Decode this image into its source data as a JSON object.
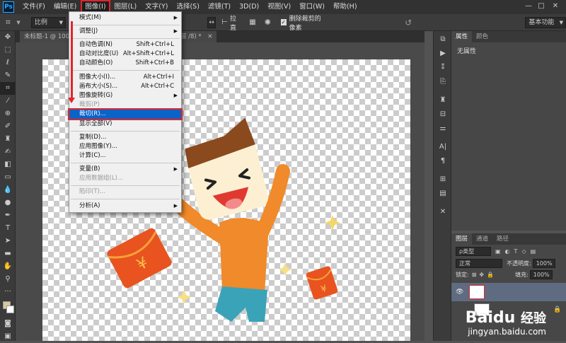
{
  "app": {
    "logo": "Ps"
  },
  "menubar": {
    "items": [
      "文件(F)",
      "编辑(E)",
      "图像(I)",
      "图层(L)",
      "文字(Y)",
      "选择(S)",
      "滤镜(T)",
      "3D(D)",
      "视图(V)",
      "窗口(W)",
      "帮助(H)"
    ],
    "active_index": 2,
    "window_controls": [
      "—",
      "□",
      "✕"
    ]
  },
  "options_bar": {
    "crop_icon": "crop-icon",
    "ratio_label": "比例",
    "straighten_label": "拉直",
    "delete_cropped_label": "删除裁剪的像素",
    "delete_cropped_checked": true,
    "workspace": "基本功能"
  },
  "document": {
    "tab_title": "未标题-1 @ 100%",
    "tab_title_end": "层 /8) *"
  },
  "image_menu": {
    "items": [
      {
        "label": "模式(M)",
        "shortcut": "",
        "submenu": true,
        "disabled": false,
        "highlighted": false
      },
      {
        "label": "调整(J)",
        "shortcut": "",
        "submenu": true,
        "disabled": false,
        "highlighted": false
      },
      {
        "label": "自动色调(N)",
        "shortcut": "Shift+Ctrl+L",
        "submenu": false,
        "disabled": false,
        "highlighted": false
      },
      {
        "label": "自动对比度(U)",
        "shortcut": "Alt+Shift+Ctrl+L",
        "submenu": false,
        "disabled": false,
        "highlighted": false
      },
      {
        "label": "自动颜色(O)",
        "shortcut": "Shift+Ctrl+B",
        "submenu": false,
        "disabled": false,
        "highlighted": false
      },
      {
        "label": "图像大小(I)...",
        "shortcut": "Alt+Ctrl+I",
        "submenu": false,
        "disabled": false,
        "highlighted": false
      },
      {
        "label": "画布大小(S)...",
        "shortcut": "Alt+Ctrl+C",
        "submenu": false,
        "disabled": false,
        "highlighted": false
      },
      {
        "label": "图像旋转(G)",
        "shortcut": "",
        "submenu": true,
        "disabled": false,
        "highlighted": false
      },
      {
        "label": "裁剪(P)",
        "shortcut": "",
        "submenu": false,
        "disabled": true,
        "highlighted": false
      },
      {
        "label": "裁切(R)...",
        "shortcut": "",
        "submenu": false,
        "disabled": false,
        "highlighted": true
      },
      {
        "label": "显示全部(V)",
        "shortcut": "",
        "submenu": false,
        "disabled": false,
        "highlighted": false
      },
      {
        "label": "复制(D)...",
        "shortcut": "",
        "submenu": false,
        "disabled": false,
        "highlighted": false
      },
      {
        "label": "应用图像(Y)...",
        "shortcut": "",
        "submenu": false,
        "disabled": false,
        "highlighted": false
      },
      {
        "label": "计算(C)...",
        "shortcut": "",
        "submenu": false,
        "disabled": false,
        "highlighted": false
      },
      {
        "label": "变量(B)",
        "shortcut": "",
        "submenu": true,
        "disabled": false,
        "highlighted": false
      },
      {
        "label": "应用数据组(L)...",
        "shortcut": "",
        "submenu": false,
        "disabled": true,
        "highlighted": false
      },
      {
        "label": "陷印(T)...",
        "shortcut": "",
        "submenu": false,
        "disabled": true,
        "highlighted": false
      },
      {
        "label": "分析(A)",
        "shortcut": "",
        "submenu": true,
        "disabled": false,
        "highlighted": false
      }
    ]
  },
  "properties_panel": {
    "tabs": [
      "属性",
      "颜色"
    ],
    "empty_text": "无属性"
  },
  "layers_panel": {
    "tabs": [
      "图层",
      "通道",
      "路径"
    ],
    "filter_label": "ρ类型",
    "blend_mode": "正常",
    "opacity_label": "不透明度:",
    "opacity_value": "100%",
    "lock_label": "锁定:",
    "fill_label": "填充:",
    "fill_value": "100%"
  },
  "watermark": {
    "brand": "Baidu",
    "product": "经验",
    "url": "jingyan.baidu.com"
  },
  "colors": {
    "accent_red": "#e0262b",
    "menu_highlight": "#0a64c8",
    "character_shirt": "#f08a2a",
    "envelope": "#e8531f"
  }
}
